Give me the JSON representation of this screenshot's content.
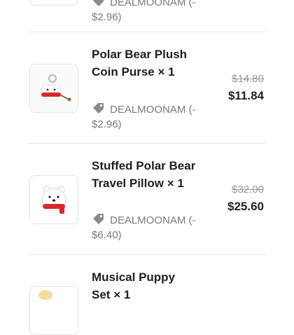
{
  "items": [
    {
      "coupon_text": "DEALMOONAM (-",
      "coupon_amount": "$2.96)"
    },
    {
      "name_line1": "Polar Bear Plush",
      "name_line2": "Coin Purse",
      "qty": "× 1",
      "original_price": "$14.80",
      "price": "$11.84",
      "coupon_text": "DEALMOONAM (-",
      "coupon_amount": "$2.96)",
      "thumbnail_icon": "polar-bear-coin-purse"
    },
    {
      "name_line1": "Stuffed Polar Bear",
      "name_line2": "Travel Pillow",
      "qty": "× 1",
      "original_price": "$32.00",
      "price": "$25.60",
      "coupon_text": "DEALMOONAM (-",
      "coupon_amount": "$6.40)",
      "thumbnail_icon": "polar-bear-pillow"
    },
    {
      "name_line1": "Musical Puppy",
      "name_line2": "Set",
      "qty": "× 1",
      "thumbnail_icon": "musical-puppy-set"
    }
  ],
  "colors": {
    "text": "#1f1f1f",
    "muted": "#7a7a7a",
    "strike": "#9a9a9a",
    "divider": "#e6e6e6",
    "accent_red": "#d9262c"
  }
}
